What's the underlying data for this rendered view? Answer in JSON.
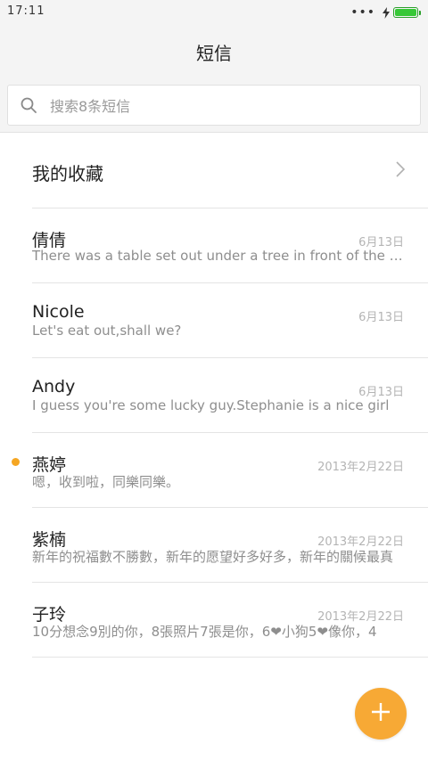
{
  "status_bar": {
    "time": "17:11",
    "dots": "•••",
    "battery_level": 1.0,
    "battery_color": "#37c837"
  },
  "header": {
    "title": "短信"
  },
  "search": {
    "placeholder": "搜索8条短信",
    "value": ""
  },
  "favorites": {
    "label": "我的收藏"
  },
  "conversations": [
    {
      "name": "倩倩",
      "date": "6月13日",
      "preview": "There was a table set out under a tree in front of the house",
      "unread": false
    },
    {
      "name": "Nicole",
      "date": "6月13日",
      "preview": "Let's eat out,shall we?",
      "unread": false
    },
    {
      "name": "Andy",
      "date": "6月13日",
      "preview": "I guess you're some lucky guy.Stephanie is a nice girl",
      "unread": false
    },
    {
      "name": "燕婷",
      "date": "2013年2月22日",
      "preview": "嗯，收到啦，同樂同樂。",
      "unread": true
    },
    {
      "name": "紫楠",
      "date": "2013年2月22日",
      "preview": "新年的祝福數不勝數，新年的愿望好多好多，新年的關候最真",
      "unread": false
    },
    {
      "name": "子玲",
      "date": "2013年2月22日",
      "preview": "10分想念9別的你，8張照片7張是你，6❤小狗5❤像你，4",
      "unread": false
    }
  ],
  "colors": {
    "accent": "#f7a935",
    "unread_dot": "#f5a623"
  },
  "icons": {
    "search": "search-icon",
    "chevron": "chevron-right-icon",
    "fab": "plus-icon"
  }
}
